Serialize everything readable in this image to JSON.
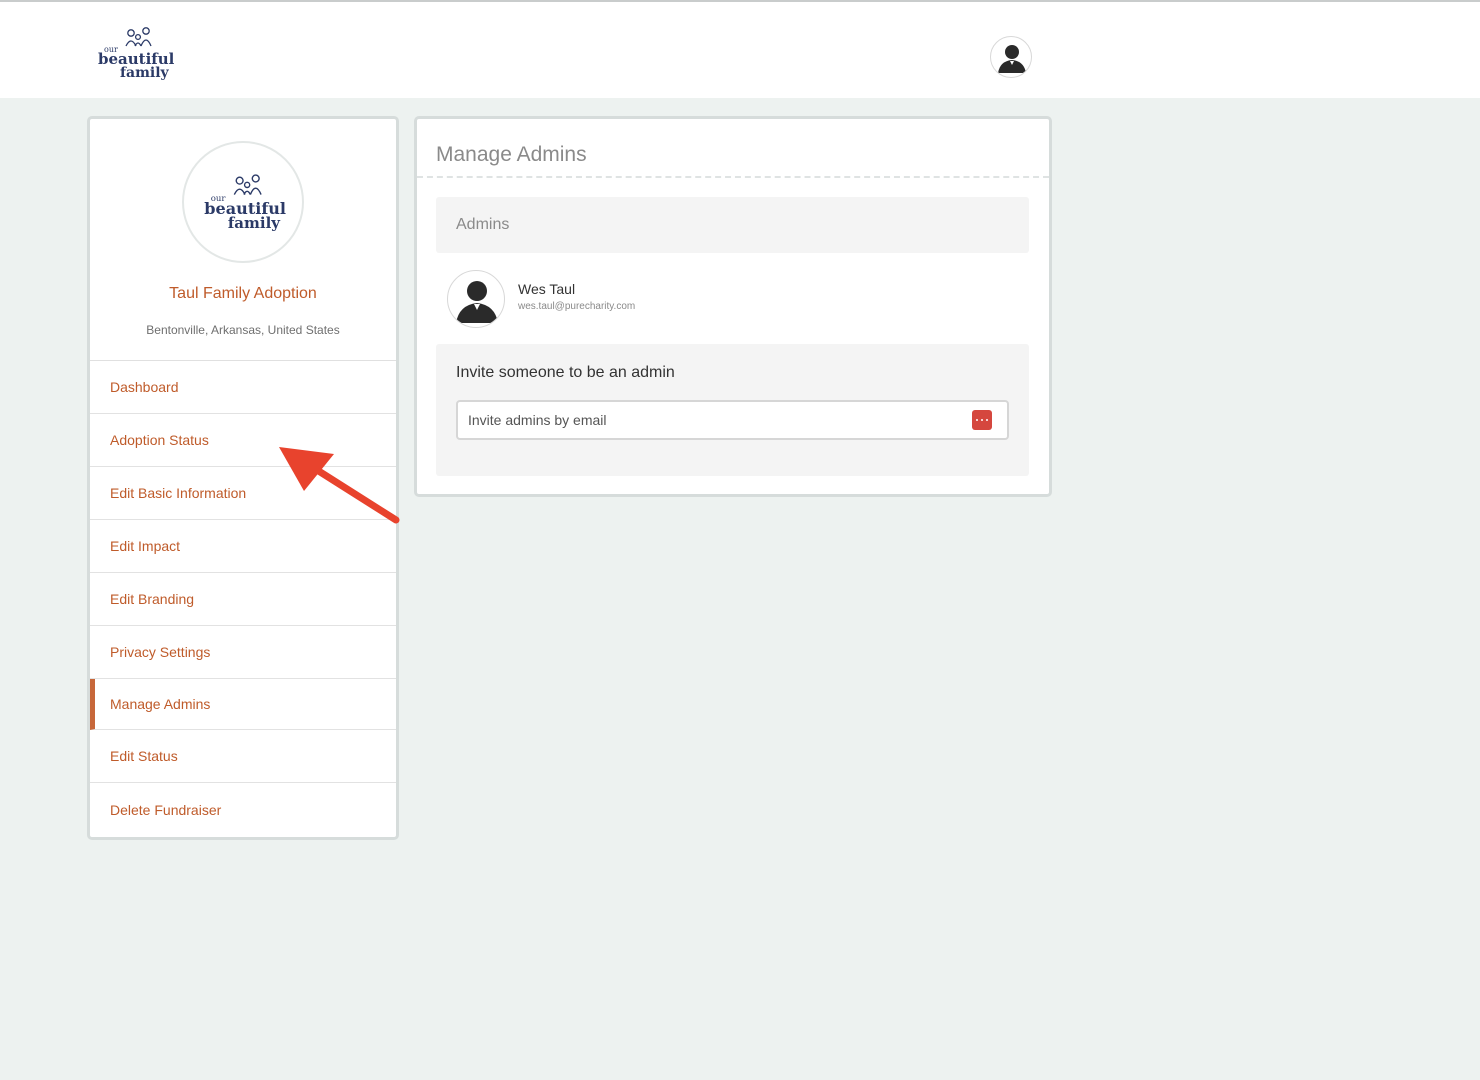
{
  "header": {
    "logo_text": [
      "our",
      "beautiful",
      "family"
    ]
  },
  "fundraiser": {
    "name": "Taul Family Adoption",
    "location": "Bentonville, Arkansas, United States"
  },
  "sidebar": {
    "items": [
      {
        "label": "Dashboard"
      },
      {
        "label": "Adoption Status"
      },
      {
        "label": "Edit Basic Information"
      },
      {
        "label": "Edit Impact"
      },
      {
        "label": "Edit Branding"
      },
      {
        "label": "Privacy Settings"
      },
      {
        "label": "Manage Admins",
        "active": true
      },
      {
        "label": "Edit Status"
      },
      {
        "label": "Delete Fundraiser"
      }
    ]
  },
  "main": {
    "title": "Manage Admins",
    "admins_header": "Admins",
    "admins": [
      {
        "name": "Wes Taul",
        "email": "wes.taul@purecharity.com"
      }
    ],
    "invite": {
      "title": "Invite someone to be an admin",
      "placeholder": "Invite admins by email"
    }
  },
  "colors": {
    "accent": "#bf5b2a",
    "annotation_arrow": "#e8432d",
    "background": "#edf2f0"
  }
}
